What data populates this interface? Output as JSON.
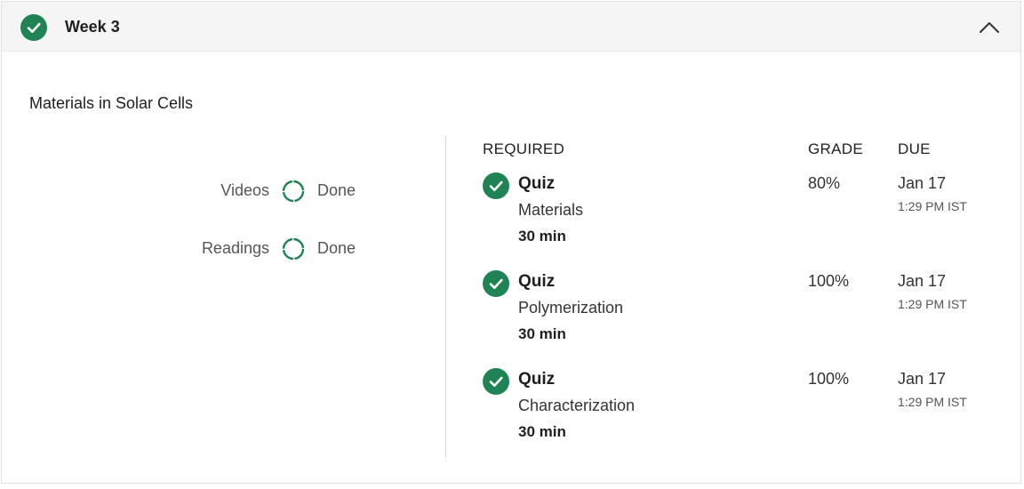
{
  "week": {
    "title": "Week 3",
    "status_icon": "check-circle-icon",
    "collapse_icon": "chevron-up-icon",
    "accent_color": "#1f8354"
  },
  "module": {
    "title": "Materials in Solar Cells"
  },
  "progress": [
    {
      "label": "Videos",
      "status": "Done",
      "icon": "progress-ring-icon"
    },
    {
      "label": "Readings",
      "status": "Done",
      "icon": "progress-ring-icon"
    }
  ],
  "columns": {
    "required": "REQUIRED",
    "grade": "GRADE",
    "due": "DUE"
  },
  "items": [
    {
      "type": "Quiz",
      "name": "Materials",
      "duration": "30 min",
      "grade": "80%",
      "due_date": "Jan 17",
      "due_time": "1:29 PM IST",
      "icon": "check-circle-icon"
    },
    {
      "type": "Quiz",
      "name": "Polymerization",
      "duration": "30 min",
      "grade": "100%",
      "due_date": "Jan 17",
      "due_time": "1:29 PM IST",
      "icon": "check-circle-icon"
    },
    {
      "type": "Quiz",
      "name": "Characterization",
      "duration": "30 min",
      "grade": "100%",
      "due_date": "Jan 17",
      "due_time": "1:29 PM IST",
      "icon": "check-circle-icon"
    }
  ]
}
